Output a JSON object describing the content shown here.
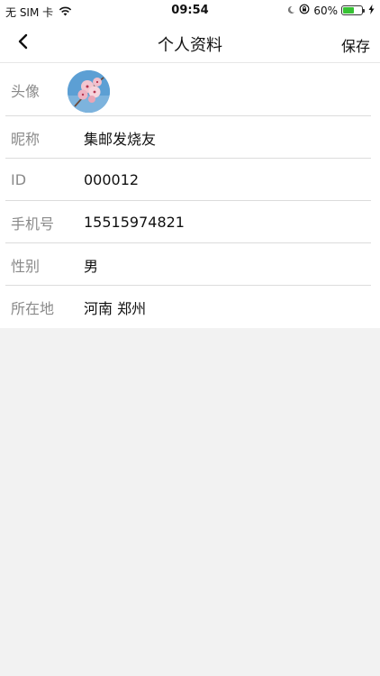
{
  "status_bar": {
    "carrier": "无 SIM 卡",
    "time": "09:54",
    "battery_percent": "60%",
    "battery_level": 0.6,
    "icons": [
      "wifi-icon",
      "moon-icon",
      "orientation-lock-icon",
      "battery-icon",
      "charging-bolt-icon"
    ]
  },
  "nav": {
    "title": "个人资料",
    "save_label": "保存",
    "back_icon": "chevron-left-icon"
  },
  "profile": {
    "avatar_label": "头像",
    "fields": [
      {
        "label": "昵称",
        "value": "集邮发烧友"
      },
      {
        "label": "ID",
        "value": "000012"
      },
      {
        "label": "手机号",
        "value": "15515974821"
      },
      {
        "label": "性别",
        "value": "男"
      },
      {
        "label": "所在地",
        "value": "河南 郑州"
      }
    ]
  },
  "colors": {
    "background": "#f2f2f2",
    "card": "#ffffff",
    "label": "#8a8a8a",
    "divider": "#dcdcdc",
    "battery_fill": "#37c234"
  }
}
